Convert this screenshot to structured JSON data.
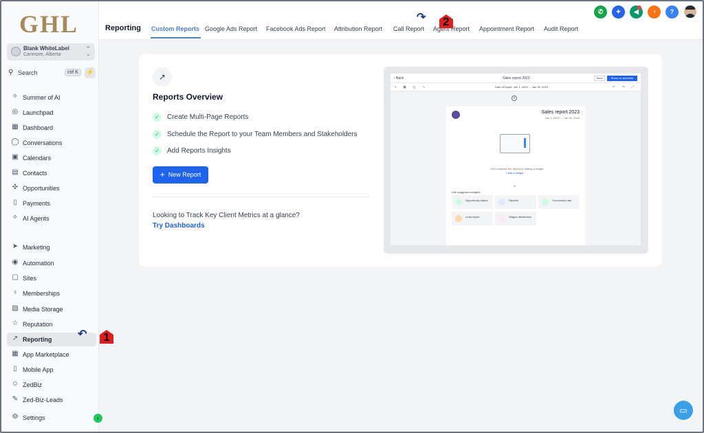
{
  "logo": "GHL",
  "account": {
    "name": "Blank WhiteLabel",
    "location": "Canmore, Alberta"
  },
  "search": {
    "label": "Search",
    "shortcut": "ctrl K"
  },
  "sidebar": {
    "items": [
      {
        "label": "Summer of AI",
        "icon": "sparkles-icon",
        "glyph": "✧"
      },
      {
        "label": "Launchpad",
        "icon": "rocket-icon",
        "glyph": "◎"
      },
      {
        "label": "Dashboard",
        "icon": "grid-icon",
        "glyph": "▦"
      },
      {
        "label": "Conversations",
        "icon": "chat-icon",
        "glyph": "◯"
      },
      {
        "label": "Calendars",
        "icon": "calendar-icon",
        "glyph": "▣"
      },
      {
        "label": "Contacts",
        "icon": "contacts-icon",
        "glyph": "▤"
      },
      {
        "label": "Opportunities",
        "icon": "opportunities-icon",
        "glyph": "✣"
      },
      {
        "label": "Payments",
        "icon": "payments-icon",
        "glyph": "▯"
      },
      {
        "label": "AI Agents",
        "icon": "ai-agents-icon",
        "glyph": "✧"
      },
      {
        "label": "Marketing",
        "icon": "send-icon",
        "glyph": "➤"
      },
      {
        "label": "Automation",
        "icon": "automation-icon",
        "glyph": "◉"
      },
      {
        "label": "Sites",
        "icon": "sites-icon",
        "glyph": "▢"
      },
      {
        "label": "Memberships",
        "icon": "membership-icon",
        "glyph": "♁"
      },
      {
        "label": "Media Storage",
        "icon": "image-icon",
        "glyph": "▨"
      },
      {
        "label": "Reputation",
        "icon": "star-icon",
        "glyph": "☆"
      },
      {
        "label": "Reporting",
        "icon": "trend-icon",
        "glyph": "↗"
      },
      {
        "label": "App Marketplace",
        "icon": "apps-icon",
        "glyph": "▦"
      },
      {
        "label": "Mobile App",
        "icon": "mobile-icon",
        "glyph": "▯"
      },
      {
        "label": "ZedBiz",
        "icon": "zedbiz-icon",
        "glyph": "☺"
      },
      {
        "label": "Zed-Biz-Leads",
        "icon": "wrench-icon",
        "glyph": "✎"
      },
      {
        "label": "Settings",
        "icon": "gear-icon",
        "glyph": "⚙"
      }
    ],
    "active": "Reporting"
  },
  "header": {
    "title": "Reporting",
    "tabs": [
      "Custom Reports",
      "Google Ads Report",
      "Facebook Ads Report",
      "Attribution Report",
      "Call Report",
      "Agent Report",
      "Appointment Report",
      "Audit Report"
    ],
    "active_tab": "Custom Reports"
  },
  "toolbar_icons": [
    {
      "name": "phone-icon",
      "color": "#16a34a",
      "glyph": "✆"
    },
    {
      "name": "magic-icon",
      "color": "#2563eb",
      "glyph": "✦"
    },
    {
      "name": "megaphone-icon",
      "color": "#059669",
      "glyph": "◀"
    },
    {
      "name": "bell-icon",
      "color": "#f97316",
      "glyph": "◔"
    },
    {
      "name": "help-icon",
      "color": "#3b82f6",
      "glyph": "?"
    }
  ],
  "overview": {
    "heading": "Reports Overview",
    "features": [
      "Create Multi-Page Reports",
      "Schedule the Report to your Team Members and Stakeholders",
      "Add Reports Insights"
    ],
    "new_report": "New Report",
    "track_text": "Looking to Track Key Client Metrics at a glance?",
    "try_link": "Try Dashboards"
  },
  "preview": {
    "back": "‹ Back",
    "title": "Sales report 2023",
    "save": "Save",
    "share": "Share or schedule",
    "date_range": "Date of report:  Jan 1, 2023  →  Jan 30, 2023",
    "report_title": "Sales report 2023",
    "report_dates": "Jan 1, 2023  →  Jan 30, 2023",
    "empty_msg": "Let's enhance the report by adding a widget",
    "add_widget": "+ Add a widget",
    "or": "or",
    "suggested": "Use suggested widgets",
    "widgets": [
      "Opportunity status",
      "Pipeline",
      "Conversion rate",
      "Lead report",
      "Stages distribution"
    ]
  },
  "annotations": [
    "1",
    "2"
  ]
}
